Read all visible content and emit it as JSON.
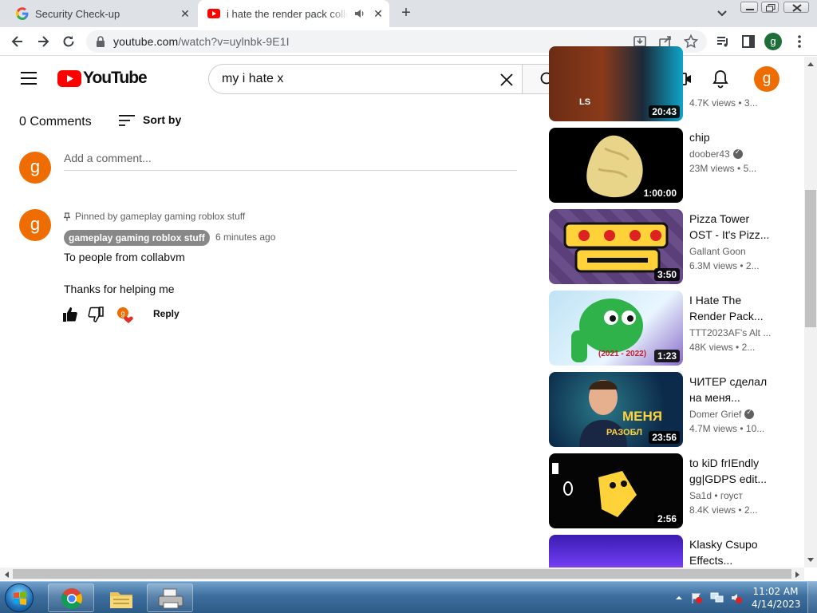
{
  "browser": {
    "tabs": [
      {
        "title": "Security Check-up",
        "active": false
      },
      {
        "title": "i hate the render pack collec",
        "active": true
      }
    ],
    "url_host": "youtube.com",
    "url_path": "/watch?v=uylnbk-9E1I",
    "profile_initial": "g"
  },
  "youtube": {
    "logo_text": "YouTube",
    "search_query": "my i hate x",
    "avatar_initial": "g"
  },
  "comments": {
    "count_label": "0 Comments",
    "sort_label": "Sort by",
    "add_placeholder": "Add a comment...",
    "pinned_label": "Pinned by gameplay gaming roblox stuff",
    "items": [
      {
        "avatar_initial": "g",
        "author": "gameplay gaming roblox stuff",
        "time": "6 minutes ago",
        "line1": "To people from collabvm",
        "line2": "Thanks for helping me",
        "reply_label": "Reply"
      }
    ]
  },
  "recommended": [
    {
      "title1": "",
      "title2": "",
      "channel": "",
      "views": "4.7K views",
      "age": "3...",
      "duration": "20:43",
      "verified": false
    },
    {
      "title1": "chip",
      "title2": "",
      "channel": "doober43",
      "views": "23M views",
      "age": "5...",
      "duration": "1:00:00",
      "verified": true
    },
    {
      "title1": "Pizza Tower",
      "title2": "OST - It's Pizz...",
      "channel": "Gallant Goon",
      "views": "6.3M views",
      "age": "2...",
      "duration": "3:50",
      "verified": false
    },
    {
      "title1": "I Hate The",
      "title2": "Render Pack...",
      "channel": "TTT2023AF's Alt ...",
      "views": "48K views",
      "age": "2...",
      "duration": "1:23",
      "verified": false
    },
    {
      "title1": "ЧИТЕР сделал",
      "title2": "на меня...",
      "channel": "Domer Grief",
      "views": "4.7M views",
      "age": "10...",
      "duration": "23:56",
      "verified": true
    },
    {
      "title1": "to kiD frIEndly",
      "title2": "gg|GDPS edit...",
      "channel": "Sa1d • гоуст",
      "views": "8.4K views",
      "age": "2...",
      "duration": "2:56",
      "verified": false
    },
    {
      "title1": "Klasky Csupo",
      "title2": "Effects...",
      "channel": "",
      "views": "",
      "age": "",
      "duration": "",
      "verified": false
    }
  ],
  "thumbnail_text": {
    "r0_brand": "LS",
    "r3_years": "(2021 - 2022)",
    "r4_word1": "МЕНЯ",
    "r4_word2": "РАЗОБЛ"
  },
  "taskbar": {
    "time": "11:02 AM",
    "date": "4/14/2023"
  },
  "colors": {
    "youtube_red": "#ff0000",
    "avatar_orange": "#ef6c00",
    "chrome_profile": "#1e6e3a",
    "taskbar_blue": "#3d6e9e"
  }
}
